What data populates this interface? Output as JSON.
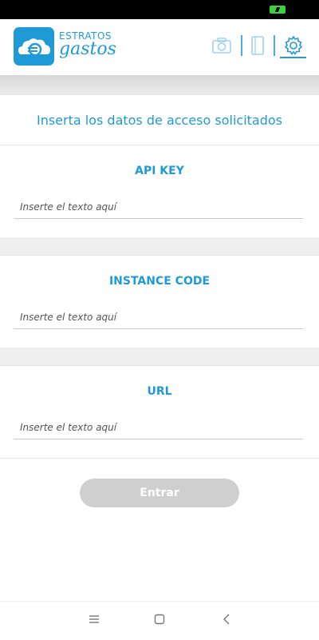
{
  "app": {
    "logo_line1": "ESTRATOS",
    "logo_line2": "gastos",
    "accent_color": "#1f9ad6"
  },
  "header": {
    "icons": [
      "camera-icon",
      "document-icon",
      "gear-icon"
    ],
    "active": "gear-icon"
  },
  "form": {
    "instruction": "Inserta los datos de acceso solicitados",
    "fields": [
      {
        "label": "API KEY",
        "placeholder": "Inserte el texto aquí",
        "value": ""
      },
      {
        "label": "INSTANCE CODE",
        "placeholder": "Inserte el texto aquí",
        "value": ""
      },
      {
        "label": "URL",
        "placeholder": "Inserte el texto aquí",
        "value": ""
      }
    ],
    "submit_label": "Entrar",
    "submit_enabled": false
  },
  "navbar": {
    "icons": [
      "menu-icon",
      "home-icon",
      "back-icon"
    ]
  }
}
